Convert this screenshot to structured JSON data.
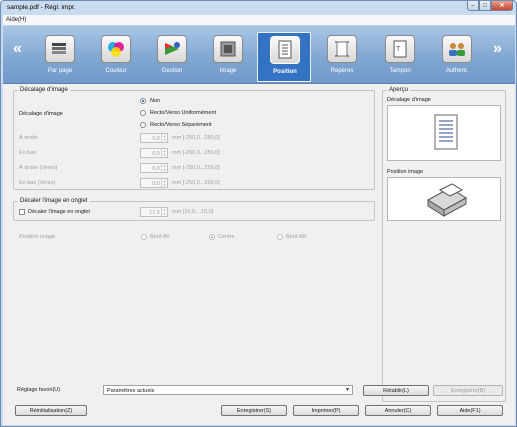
{
  "window": {
    "title": "sample.pdf - Régl. impr."
  },
  "menu": {
    "help": "Aide(H)"
  },
  "toolbar": {
    "items": [
      {
        "label": "Par page"
      },
      {
        "label": "Couleur"
      },
      {
        "label": "Gestion"
      },
      {
        "label": "Image"
      },
      {
        "label": "Position"
      },
      {
        "label": "Repères"
      },
      {
        "label": "Tampon"
      },
      {
        "label": "Authent."
      }
    ],
    "active": "Position"
  },
  "shift": {
    "group_title": "Décalage d'image",
    "label": "Décalage d'image",
    "options": [
      "Non",
      "Recto/Verso Uniformément",
      "Recto/Verso Séparément"
    ],
    "selected": "Non",
    "fields": [
      {
        "label": "À droite",
        "value": "0,0",
        "range": "mm [-250,0...250,0]"
      },
      {
        "label": "En bas",
        "value": "0,0",
        "range": "mm [-250,0...250,0]"
      },
      {
        "label": "À droite (Verso)",
        "value": "0,0",
        "range": "mm [-250,0...250,0]"
      },
      {
        "label": "En bas (Verso)",
        "value": "0,0",
        "range": "mm [-250,0...250,0]"
      }
    ]
  },
  "tab_shift": {
    "group_title": "Décaler l'image en onglet",
    "checkbox_label": "Décaler l'image en onglet",
    "value": "12,5",
    "range": "mm [10,0....15,0]"
  },
  "image_position": {
    "label": "Position image",
    "options": [
      "Bord AV",
      "Centre",
      "Bord AR"
    ],
    "selected": "Centre"
  },
  "preview": {
    "title": "Aperçu",
    "shift_title": "Décalage d'image",
    "position_title": "Position image"
  },
  "favorites": {
    "label": "Réglage favori(U)",
    "value": "Paramètres actuels",
    "restore": "Rétablir(L)",
    "save": "Enregistrer(B)"
  },
  "footer": {
    "reset": "Réinitialisation(Z)",
    "save": "Enregistrer(S)",
    "print": "Imprimer(P)",
    "cancel": "Annuler(C)",
    "help": "Aide(F1)"
  },
  "colors": {
    "toolbar": "#7fa5d1",
    "active": "#3473c4",
    "frame": "#c9dbef"
  }
}
